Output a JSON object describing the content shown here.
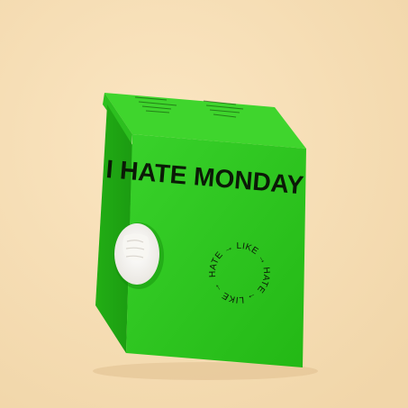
{
  "image": {
    "subject": "green product box",
    "background_color": "#f5dfb7"
  },
  "box": {
    "front_color": "#2fca1f",
    "side_color": "#25a91a",
    "top_color": "#39d32a",
    "headline": "I HATE MONDAY",
    "circular_text": "HATE → LIKE → HATE → LIKE →",
    "window_icon": "window-icon"
  }
}
